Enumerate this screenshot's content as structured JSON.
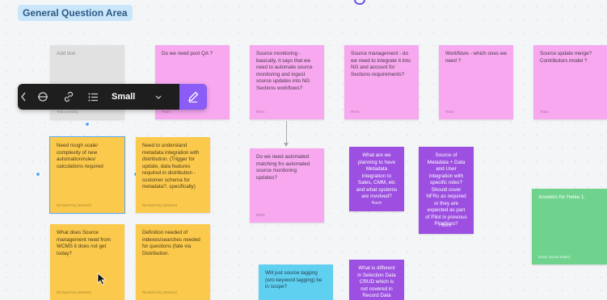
{
  "section": {
    "title": "General Question Area"
  },
  "toolbar": {
    "size_label": "Small",
    "icons": [
      "rectangle-icon",
      "strikethrough-icon",
      "link-icon",
      "list-icon",
      "chevron-down-icon",
      "pen-icon"
    ]
  },
  "stickies": {
    "s_grey": {
      "text": "Add text",
      "author": "Team posting"
    },
    "s_qa": {
      "text": "Do we need post QA ?",
      "author": "Team"
    },
    "s_monitor": {
      "text": "Source monitoring - basically, it says that we need to automate source monitoring and ingest source updates into NG Sections workflows?",
      "author": "Rens"
    },
    "s_mgmt": {
      "text": "Source management - do we need to integrate it into NG and account for Sections requirements?",
      "author": "Rens"
    },
    "s_workflows": {
      "text": "Workflows - which ones we need ?",
      "author": "Team"
    },
    "s_update": {
      "text": "Source update merge? Contributors model ?",
      "author": "Team"
    },
    "s_rough": {
      "text": "Need rough scale/ complexity of new automation/rules/ calculations required",
      "author": "Richard Key (Steiner)"
    },
    "s_understand": {
      "text": "Need to understand metadata integration with distribution. (Trigger for update, data features required in distribution - customer schema for metadata?, specifically)",
      "author": "Richard Key (Steiner)"
    },
    "s_automated": {
      "text": "Do we need automated matching fro automated source monitoring updates?",
      "author": "Rens"
    },
    "s_planning": {
      "text": "What are we planning to have Metadata integration to Sales, CMM, etc and what systems are involved?",
      "author": "Navin"
    },
    "s_source": {
      "text": "Source of Metadata + Data and User integration with specific roles? Should cover NFRs as required or they are expected as part of Pilot in previous Pipelines?",
      "author": "Navin"
    },
    "s_answers": {
      "text": "Answers for Heike 1.",
      "author": "Daisy (Sonal Majer)"
    },
    "s_wcms": {
      "text": "What does Source management need from WCMS it does not get today?",
      "author": "Richard Key (Steiner)"
    },
    "s_definition": {
      "text": "Definition needed of indexes/searches needed for questions (fate via Distribution.",
      "author": "Richard Key (Steiner)"
    },
    "s_tagging": {
      "text": "Will just source tagging (w/o keyword tagging) be in scope?",
      "author": ""
    },
    "s_different": {
      "text": "What is different in Selection Data CRUD which is not covered in Record Data CRUD?",
      "author": ""
    }
  },
  "colors": {
    "grey": "#e1e1e1",
    "pink": "#f7a8ef",
    "yellow": "#fbc94b",
    "violet": "#9c4fe0",
    "green": "#6fd38e",
    "cyan": "#5fd0f0",
    "toolbar": "#1e1e1e",
    "accent": "#8b5cf6",
    "selection": "#59a9f2"
  }
}
